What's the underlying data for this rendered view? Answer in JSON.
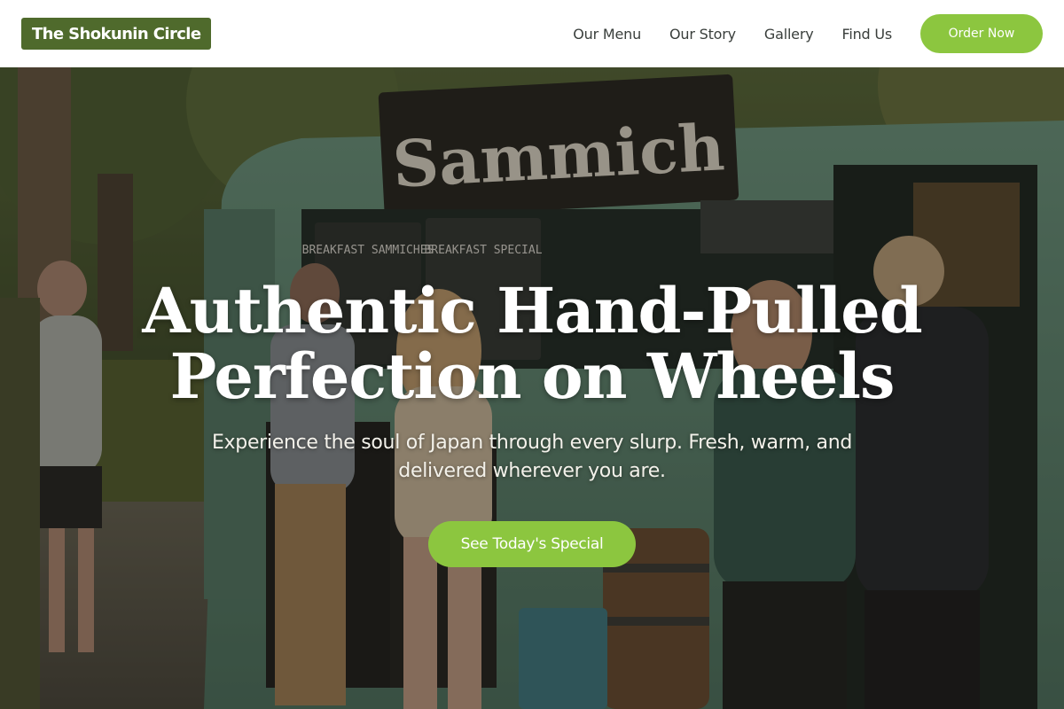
{
  "brand": {
    "name": "The Shokunin Circle",
    "accent": "#8cc63f",
    "logo_bg": "#4f6a2c"
  },
  "nav": {
    "links": [
      "Our Menu",
      "Our Story",
      "Gallery",
      "Find Us"
    ],
    "order_label": "Order Now"
  },
  "hero": {
    "title": "Authentic Hand-Pulled Perfection on Wheels",
    "subtitle": "Experience the soul of Japan through every slurp. Fresh, warm, and delivered wherever you are.",
    "cta_label": "See Today's Special",
    "truck_sign": "Sammich",
    "chalkboard_left": "BREAKFAST SAMMICHES",
    "chalkboard_center": "BREAKFAST SPECIAL"
  }
}
